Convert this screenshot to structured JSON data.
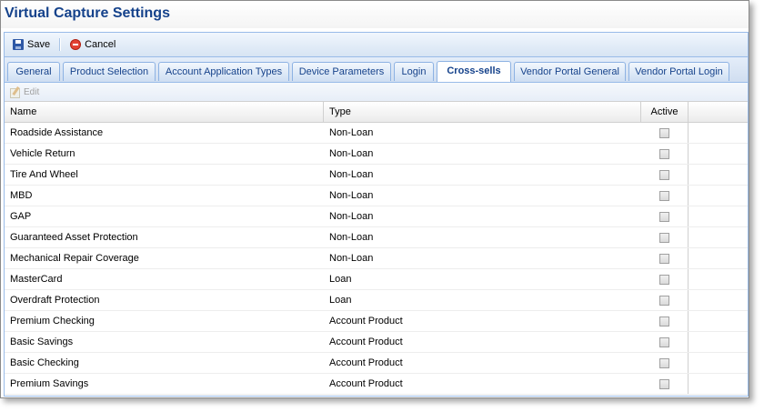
{
  "window": {
    "title": "Virtual Capture Settings"
  },
  "toolbar": {
    "save_label": "Save",
    "cancel_label": "Cancel"
  },
  "tabs": [
    {
      "label": "General"
    },
    {
      "label": "Product Selection"
    },
    {
      "label": "Account Application Types"
    },
    {
      "label": "Device Parameters"
    },
    {
      "label": "Login"
    },
    {
      "label": "Cross-sells",
      "active": true
    },
    {
      "label": "Vendor Portal General"
    },
    {
      "label": "Vendor Portal Login"
    }
  ],
  "subtoolbar": {
    "edit_label": "Edit"
  },
  "grid": {
    "columns": {
      "name": "Name",
      "type": "Type",
      "active": "Active"
    },
    "rows": [
      {
        "name": "Roadside Assistance",
        "type": "Non-Loan",
        "active": false
      },
      {
        "name": "Vehicle Return",
        "type": "Non-Loan",
        "active": false
      },
      {
        "name": "Tire And Wheel",
        "type": "Non-Loan",
        "active": false
      },
      {
        "name": "MBD",
        "type": "Non-Loan",
        "active": false
      },
      {
        "name": "GAP",
        "type": "Non-Loan",
        "active": false
      },
      {
        "name": "Guaranteed Asset Protection",
        "type": "Non-Loan",
        "active": false
      },
      {
        "name": "Mechanical Repair Coverage",
        "type": "Non-Loan",
        "active": false
      },
      {
        "name": "MasterCard",
        "type": "Loan",
        "active": false
      },
      {
        "name": "Overdraft Protection",
        "type": "Loan",
        "active": false
      },
      {
        "name": "Premium Checking",
        "type": "Account Product",
        "active": false
      },
      {
        "name": "Basic Savings",
        "type": "Account Product",
        "active": false
      },
      {
        "name": "Basic Checking",
        "type": "Account Product",
        "active": false
      },
      {
        "name": "Premium Savings",
        "type": "Account Product",
        "active": false
      }
    ]
  },
  "colors": {
    "title_text": "#15428b",
    "panel_border": "#99bbe8",
    "tab_text": "#15428b"
  }
}
